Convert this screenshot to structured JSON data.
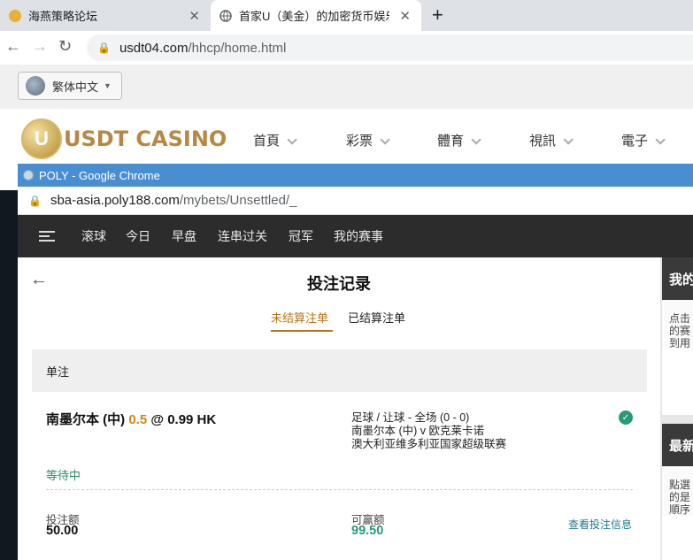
{
  "browser": {
    "tabs": [
      {
        "label": "海燕策略论坛",
        "close": "✕"
      },
      {
        "label": "首家U（美金）的加密货币娱乐城",
        "close": "✕"
      }
    ],
    "new_tab": "+",
    "url_host": "usdt04.com",
    "url_path": "/hhcp/home.html"
  },
  "site": {
    "language": "繁体中文",
    "logo_text": "USDT CASINO",
    "logo_mark": "U",
    "nav": [
      "首頁",
      "彩票",
      "體育",
      "視訊",
      "電子"
    ]
  },
  "popup": {
    "title": "POLY - Google Chrome",
    "url_host": "sba-asia.poly188.com",
    "url_path": "/mybets/Unsettled/_",
    "nav": [
      "滚球",
      "今日",
      "早盘",
      "连串过关",
      "冠军",
      "我的赛事"
    ],
    "page_title": "投注记录",
    "tabs": [
      "未结算注单",
      "已结算注单"
    ],
    "section": "单注",
    "bet": {
      "team": "南墨尔本 (中)",
      "handicap": "0.5",
      "at": "@",
      "odds": "0.99 HK",
      "market": "足球 / 让球 - 全场 (0 - 0)",
      "match": "南墨尔本 (中) v 欧克莱卡诺",
      "league": "澳大利亚维多利亚国家超级联赛",
      "status": "等待中",
      "stake_label": "投注额",
      "stake": "50.00",
      "win_label": "可赢额",
      "win": "99.50",
      "view_details": "查看投注信息"
    },
    "right_cards": [
      {
        "head": "我的",
        "body": [
          "点击",
          "的赛",
          "到用"
        ]
      },
      {
        "head": "最新",
        "body": [
          "點選",
          "的是",
          "順序"
        ]
      }
    ]
  },
  "colors": {
    "accent": "#b5761a",
    "positive": "#2a9a72",
    "popup_title_bar": "#4a8ed2",
    "sba_nav": "#2c2c2c"
  }
}
